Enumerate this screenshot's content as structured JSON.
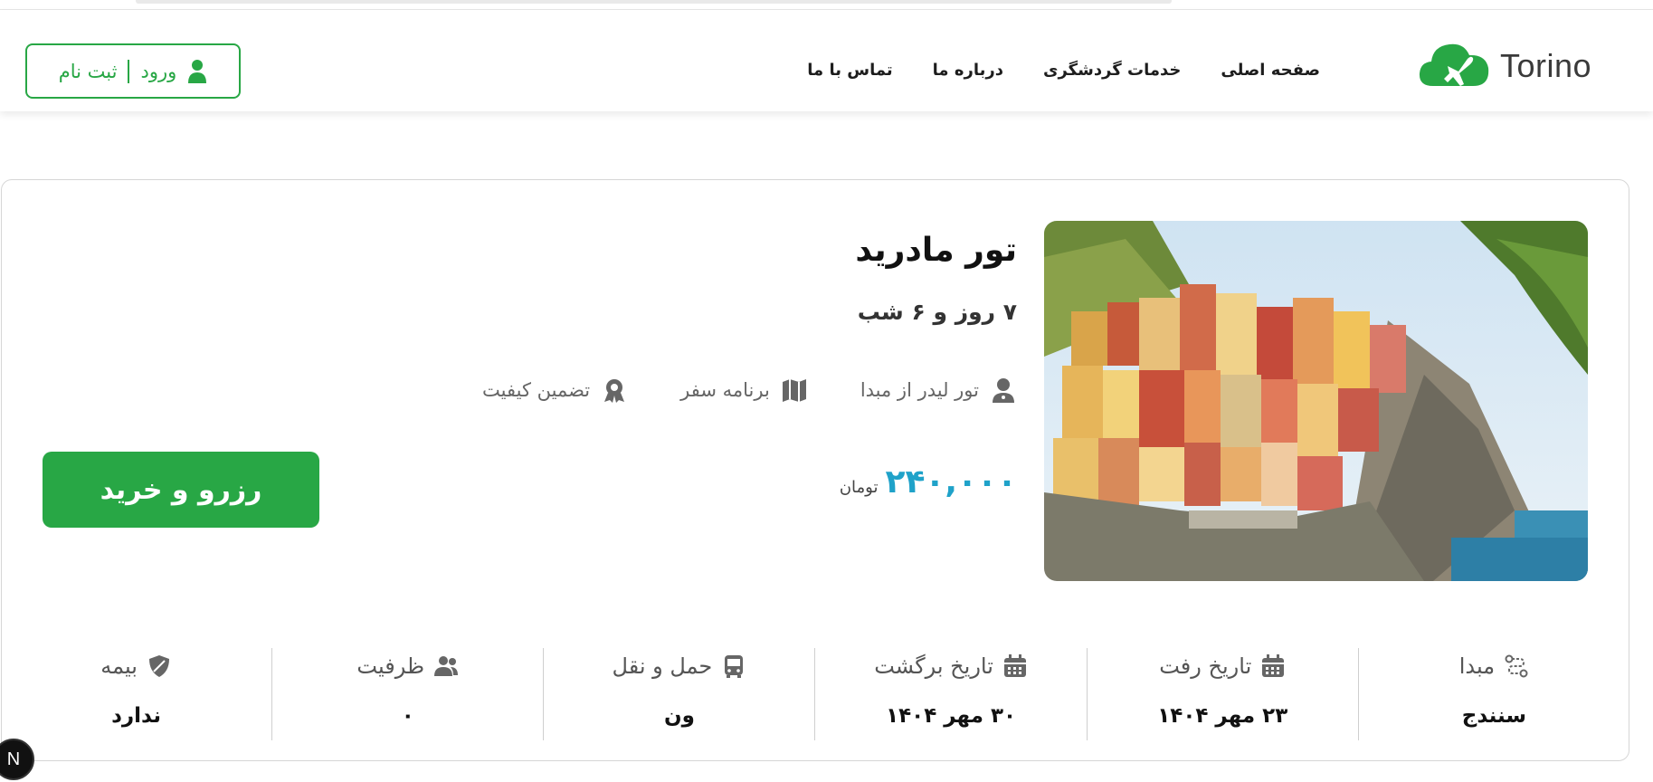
{
  "brand": {
    "name": "Torino",
    "color": "#28a745"
  },
  "nav": {
    "items": [
      {
        "label": "صفحه اصلی"
      },
      {
        "label": "خدمات گردشگری"
      },
      {
        "label": "درباره ما"
      },
      {
        "label": "تماس با ما"
      }
    ]
  },
  "auth": {
    "login": "ورود",
    "register": "ثبت نام"
  },
  "tour": {
    "title": "تور مادرید",
    "duration": "۷ روز و ۶ شب",
    "features": [
      {
        "icon": "person-badge-icon",
        "label": "تور لیدر از مبدا"
      },
      {
        "icon": "map-icon",
        "label": "برنامه سفر"
      },
      {
        "icon": "award-icon",
        "label": "تضمین کیفیت"
      }
    ],
    "price": {
      "amount": "۲۴۰,۰۰۰",
      "currency": "تومان",
      "color": "#1fa2c9"
    },
    "buy_label": "رزرو و خرید"
  },
  "details": [
    {
      "icon": "route-icon",
      "label": "مبدا",
      "value": "سنندج"
    },
    {
      "icon": "calendar-icon",
      "label": "تاریخ رفت",
      "value": "۲۳ مهر ۱۴۰۴"
    },
    {
      "icon": "calendar-icon",
      "label": "تاریخ برگشت",
      "value": "۳۰ مهر ۱۴۰۴"
    },
    {
      "icon": "bus-icon",
      "label": "حمل و نقل",
      "value": "ون"
    },
    {
      "icon": "users-icon",
      "label": "ظرفیت",
      "value": "۰"
    },
    {
      "icon": "shield-icon",
      "label": "بیمه",
      "value": "ندارد"
    }
  ],
  "badge": {
    "letter": "N"
  }
}
